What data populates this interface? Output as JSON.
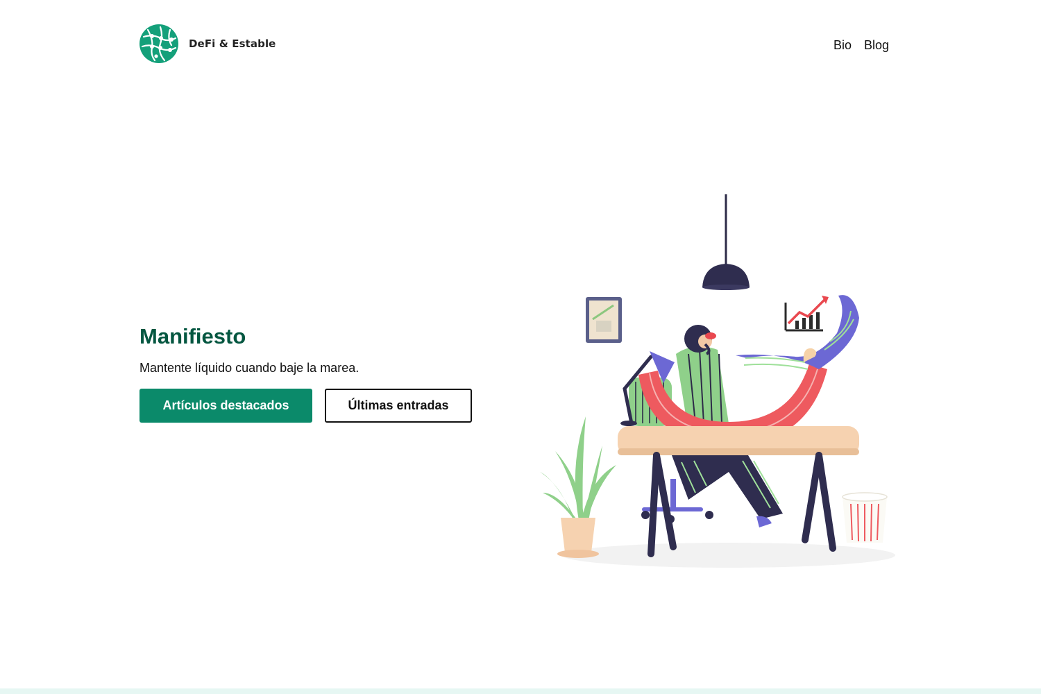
{
  "header": {
    "site_name": "DeFi & Estable",
    "logo_icon": "network-globe-icon",
    "nav": [
      {
        "label": "Bio"
      },
      {
        "label": "Blog"
      }
    ]
  },
  "hero": {
    "title": "Manifiesto",
    "subtitle": "Mantente líquido cuando baje la marea.",
    "primary_button": "Artículos destacados",
    "secondary_button": "Últimas entradas",
    "illustration": "person-at-desk-illustration"
  },
  "colors": {
    "brand_green": "#0b8a6a",
    "title_green": "#045640",
    "footer_tint": "#e6f7f3"
  }
}
